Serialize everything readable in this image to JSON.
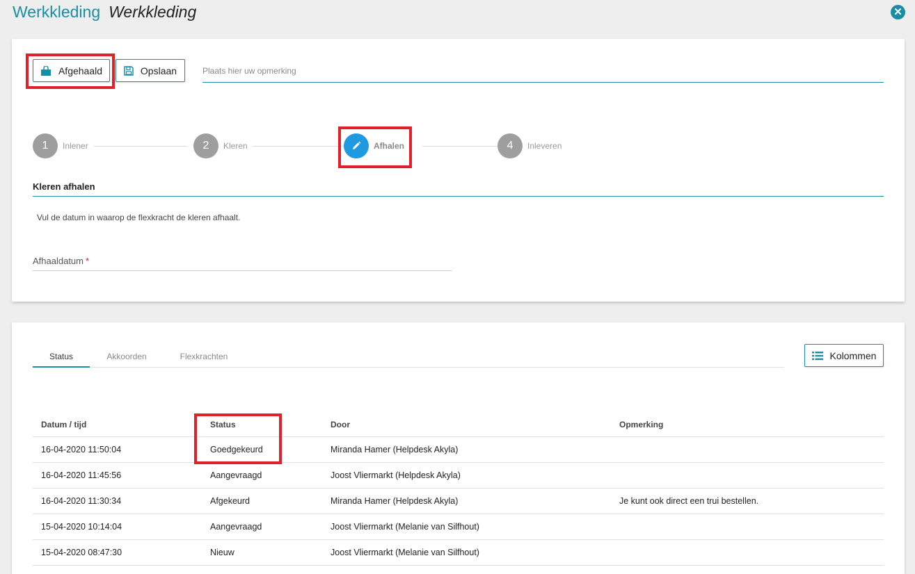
{
  "header": {
    "title": "Werkkleding",
    "subtitle": "Werkkleding",
    "close_icon": "close-icon"
  },
  "toolbar": {
    "afgehaald_label": "Afgehaald",
    "afgehaald_icon": "shopping-bag-icon",
    "opslaan_label": "Opslaan",
    "opslaan_icon": "floppy-disk-icon",
    "remark_placeholder": "Plaats hier uw opmerking"
  },
  "stepper": {
    "steps": [
      {
        "number": "1",
        "label": "Inlener"
      },
      {
        "number": "2",
        "label": "Kleren"
      },
      {
        "number": "",
        "label": "Afhalen",
        "icon": "pencil-icon",
        "active": true
      },
      {
        "number": "4",
        "label": "Inleveren"
      }
    ]
  },
  "section": {
    "title": "Kleren afhalen",
    "description": "Vul de datum in waarop de flexkracht de kleren afhaalt.",
    "field_label": "Afhaaldatum",
    "required_mark": "*"
  },
  "tabs": [
    {
      "label": "Status",
      "active": true
    },
    {
      "label": "Akkoorden",
      "active": false
    },
    {
      "label": "Flexkrachten",
      "active": false
    }
  ],
  "kolommen": {
    "label": "Kolommen",
    "icon": "list-icon"
  },
  "table": {
    "columns": [
      "Datum / tijd",
      "Status",
      "Door",
      "Opmerking"
    ],
    "rows": [
      [
        "16-04-2020 11:50:04",
        "Goedgekeurd",
        "Miranda Hamer (Helpdesk Akyla)",
        ""
      ],
      [
        "16-04-2020 11:45:56",
        "Aangevraagd",
        "Joost Vliermarkt (Helpdesk Akyla)",
        ""
      ],
      [
        "16-04-2020 11:30:34",
        "Afgekeurd",
        "Miranda Hamer (Helpdesk Akyla)",
        "Je kunt ook direct een trui bestellen."
      ],
      [
        "15-04-2020 10:14:04",
        "Aangevraagd",
        "Joost Vliermarkt (Melanie van Silfhout)",
        ""
      ],
      [
        "15-04-2020 08:47:30",
        "Nieuw",
        "Joost Vliermarkt (Melanie van Silfhout)",
        ""
      ]
    ]
  },
  "colors": {
    "accent": "#1a8ca3",
    "active_step": "#1e9ae0",
    "highlight": "#e0202a"
  }
}
